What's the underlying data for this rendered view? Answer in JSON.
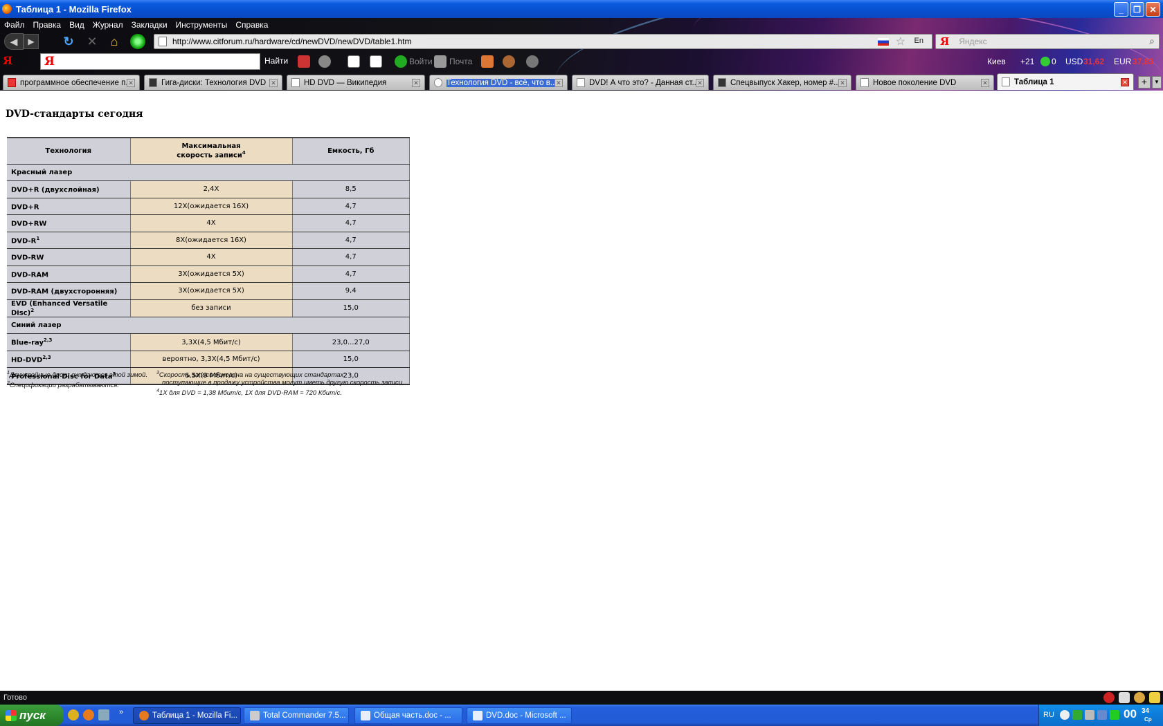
{
  "window": {
    "title": "Таблица 1 - Mozilla Firefox"
  },
  "menu": [
    "Файл",
    "Правка",
    "Вид",
    "Журнал",
    "Закладки",
    "Инструменты",
    "Справка"
  ],
  "navbar": {
    "url": "http://www.citforum.ru/hardware/cd/newDVD/newDVD/table1.htm",
    "lang_indicator": "En",
    "search_logo": "Я",
    "search_placeholder": "Яндекс"
  },
  "yandex_bar": {
    "logo": "Я",
    "input_logo": "Я",
    "find_label": "Найти",
    "login_label": "Войти",
    "mail_label": "Почта",
    "city": "Киев",
    "temperature": "+21",
    "count": "0",
    "usd_label": "USD",
    "usd_value": "31,62",
    "eur_label": "EUR",
    "eur_value": "37,83"
  },
  "tabs": [
    {
      "label": "программное обеспечение п...",
      "active": false
    },
    {
      "label": "Гига-диски: Технология DVD",
      "active": false
    },
    {
      "label": "HD DVD — Википедия",
      "active": false
    },
    {
      "label": "Технология DVD - всё, что в...",
      "active": false,
      "loading": true
    },
    {
      "label": "DVD! А что это? - Данная ст...",
      "active": false
    },
    {
      "label": "Спецвыпуск Хакер, номер #...",
      "active": false
    },
    {
      "label": "Новое поколение DVD",
      "active": false
    },
    {
      "label": "Таблица 1",
      "active": true
    }
  ],
  "page": {
    "heading": "DVD-стандарты сегодня",
    "table": {
      "headers": {
        "technology": "Технология",
        "speed_line1": "Максимальная",
        "speed_line2": "скорость записи",
        "speed_sup": "4",
        "capacity": "Емкость, Гб"
      },
      "section_red": "Красный лазер",
      "red_rows": [
        {
          "tech": "DVD+R (двухслойная)",
          "sup": "",
          "speed": "2,4X",
          "cap": "8,5"
        },
        {
          "tech": "DVD+R",
          "sup": "",
          "speed": "12X(ожидается 16X)",
          "cap": "4,7"
        },
        {
          "tech": "DVD+RW",
          "sup": "",
          "speed": "4X",
          "cap": "4,7"
        },
        {
          "tech": "DVD-R",
          "sup": "1",
          "speed": "8X(ожидается 16X)",
          "cap": "4,7"
        },
        {
          "tech": "DVD-RW",
          "sup": "",
          "speed": "4X",
          "cap": "4,7"
        },
        {
          "tech": "DVD-RAM",
          "sup": "",
          "speed": "3X(ожидается 5X)",
          "cap": "4,7"
        },
        {
          "tech": "DVD-RAM (двухсторонняя)",
          "sup": "",
          "speed": "3X(ожидается 5X)",
          "cap": "9,4"
        },
        {
          "tech": "EVD (Enhanced Versatile Disc)",
          "sup": "2",
          "speed": "без записи",
          "cap": "15,0"
        }
      ],
      "section_blue": "Синий лазер",
      "blue_rows": [
        {
          "tech": "Blue-ray",
          "sup": "2,3",
          "speed": "3,3X(4,5 Мбит/с)",
          "cap": "23,0...27,0"
        },
        {
          "tech": "HD-DVD",
          "sup": "2,3",
          "speed": "вероятно, 3,3X(4,5 Мбит/с)",
          "cap": "15,0"
        },
        {
          "tech": "Professional Disc for Data",
          "sup": "3",
          "speed": "6,5X(9 Мбит/с)",
          "cap": "23,0"
        }
      ]
    },
    "footnotes": {
      "n1_mark": "1",
      "n1": "Двухслойные диски ожидаются этой зимой.",
      "n2_mark": "2",
      "n2": "Спецификации разрабатываются.",
      "n3_mark": "3",
      "n3_line1": "Скорость записи основана на существующих стандартах;",
      "n3_line2": "поступающие в продажу устройства могут иметь другую скорость записи.",
      "n4_mark": "4",
      "n4": "1X для DVD = 1,38 Мбит/с, 1X для DVD-RAM = 720 Кбит/с."
    }
  },
  "statusbar": {
    "text": "Готово"
  },
  "taskbar": {
    "start_label": "пуск",
    "tasks": [
      {
        "label": "Таблица 1 - Mozilla Fi...",
        "active": true
      },
      {
        "label": "Total Commander 7.5...",
        "active": false
      },
      {
        "label": "Общая часть.doc - ...",
        "active": false
      },
      {
        "label": "DVD.doc - Microsoft ...",
        "active": false
      }
    ],
    "lang": "RU",
    "clock_hour": "00",
    "clock_min": "34",
    "clock_day": "Ср"
  }
}
